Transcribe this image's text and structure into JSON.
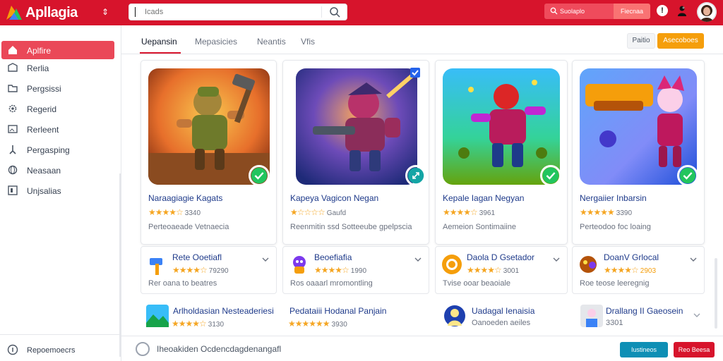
{
  "app": {
    "name": "Apllagia"
  },
  "search": {
    "value": "",
    "placeholder": "Icads"
  },
  "header": {
    "search_pill_label": "Suolaplo",
    "action_label": "Fiecnaa"
  },
  "sidebar": {
    "items": [
      {
        "label": "Aplfire",
        "icon": "home-icon",
        "active": true
      },
      {
        "label": "Rerlia",
        "icon": "box-icon"
      },
      {
        "label": "Pergsissi",
        "icon": "folder-icon"
      },
      {
        "label": "Regerid",
        "icon": "gear-icon"
      },
      {
        "label": "Rerleent",
        "icon": "image-icon"
      },
      {
        "label": "Pergasping",
        "icon": "tool-icon"
      },
      {
        "label": "Neasaan",
        "icon": "globe-icon"
      },
      {
        "label": "Unjsalias",
        "icon": "grid-icon"
      }
    ],
    "footer_label": "Repoemoecrs"
  },
  "tabs": [
    {
      "label": "Uepansin",
      "active": true
    },
    {
      "label": "Mepasicies"
    },
    {
      "label": "Neantis"
    },
    {
      "label": "Vfis"
    }
  ],
  "toolbar": {
    "plain_label": "Paitio",
    "primary_label": "Asecoboes"
  },
  "featured": [
    {
      "title": "Naraagiagie Kagats",
      "stars": "★★★★☆",
      "rating": "3340",
      "subtitle": "Perteoaeade Vetnaecia",
      "badge": "check"
    },
    {
      "title": "Kapeya Vagicon Negan",
      "stars": "★☆☆☆☆",
      "rating": "Gaufd",
      "subtitle": "Reenmitin ssd Sotteeube gpelpscia",
      "badge": "expand"
    },
    {
      "title": "Kepale Iagan Negyan",
      "stars": "★★★★☆",
      "rating": "3961",
      "subtitle": "Aemeion Sontimaiine",
      "badge": "check"
    },
    {
      "title": "Nergaiier Inbarsin",
      "stars": "★★★★★",
      "rating": "3390",
      "subtitle": "Perteodoo foc loaing",
      "badge": "check"
    }
  ],
  "list_items": [
    {
      "title": "Rete Ooetiafl",
      "stars": "★★★★☆",
      "rating": "79290",
      "subtitle": "Rer oana to beatres",
      "icon": "hammer-icon"
    },
    {
      "title": "Beoefiafia",
      "stars": "★★★★☆",
      "rating": "1990",
      "subtitle": "Ros oaaarl mromontling",
      "icon": "robot-icon"
    },
    {
      "title": "Daola D Gsetador",
      "stars": "★★★★☆",
      "rating": "3001",
      "subtitle": "Tvise ooar beaoiale",
      "icon": "coin-icon"
    },
    {
      "title": "DoanV Grlocal",
      "stars": "★★★★☆",
      "rating": "2903",
      "subtitle": "Roe teose leeregnig",
      "icon": "beast-icon"
    }
  ],
  "bottom_items": [
    {
      "title": "Arlholdasian Nesteaderiesi",
      "stars": "★★★★☆",
      "rating": "3130",
      "icon": "landscape-icon"
    },
    {
      "title": "Pedataiii Hodanal Panjain",
      "stars": "★★★★★★",
      "rating": "3930"
    },
    {
      "title": "Uadagal Ienaisia",
      "subtitle": "Oanoeden aeiles",
      "icon": "character-icon"
    },
    {
      "title": "Drallang II Gaeosein",
      "subtitle": "3301",
      "icon": "portrait-icon"
    }
  ],
  "footer": {
    "text": "Iheoakiden Ocdencdagdenangafl",
    "teal_label": "Iustineos",
    "red_label": "Reo Beesa"
  },
  "colors": {
    "brand": "#d7142c",
    "accent_orange": "#f59e0b",
    "teal": "#0e8fb5",
    "badge_green": "#22c55e",
    "star": "#f5a623"
  }
}
